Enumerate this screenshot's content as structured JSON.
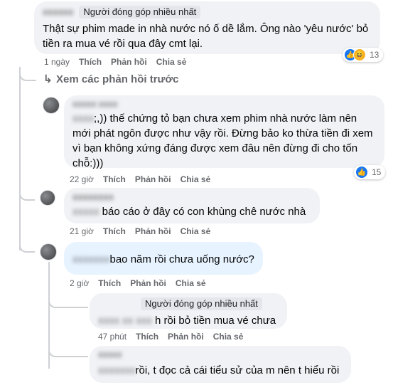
{
  "top_comment": {
    "badge": "Người đóng góp nhiều nhất",
    "text": "Thật sự phim made in nhà nước nó ố dề lắm. Ông nào 'yêu nước' bỏ tiền ra mua vé rồi qua đây cmt lại.",
    "time": "1 ngày",
    "like": "Thích",
    "reply": "Phản hồi",
    "share": "Chia sẻ",
    "reaction_count": "13"
  },
  "view_previous": "Xem các phản hồi trước",
  "reply1": {
    "text": ";,)) thế chứng tỏ bạn chưa xem phim nhà nước làm nên mới phát ngôn được như vậy rồi. Đừng bảo ko thừa tiền đi xem vì bạn không xứng đáng được xem đâu nên đừng đi cho tốn chỗ:)))",
    "time": "22 giờ",
    "like": "Thích",
    "reply": "Phản hồi",
    "share": "Chia sẻ",
    "reaction_count": "15"
  },
  "reply2": {
    "text": "báo cáo ở đây có con khùng chê nước nhà",
    "time": "21 giờ",
    "like": "Thích",
    "reply": "Phản hồi",
    "share": "Chia sẻ"
  },
  "reply3": {
    "text": "bao năm rồi chưa uống nước?",
    "time": "2 giờ",
    "like": "Thích",
    "reply": "Phản hồi",
    "share": "Chia sẻ"
  },
  "reply4": {
    "badge": "Người đóng góp nhiều nhất",
    "text": "h rồi bỏ tiền mua vé chưa",
    "time": "47 phút",
    "like": "Thích",
    "reply": "Phản hồi",
    "share": "Chia sẻ"
  },
  "reply5": {
    "text": "rồi, t đọc cả cái tiểu sử của m nên t hiểu rồi"
  },
  "colors": {
    "like": "#1877f2",
    "bubble": "#f0f2f5",
    "bubble_active": "#e7f3ff",
    "meta": "#65676b"
  },
  "icons": {
    "reply_arrow": "reply-arrow-icon",
    "like_reaction": "like-reaction-icon",
    "haha_reaction": "haha-reaction-icon"
  }
}
